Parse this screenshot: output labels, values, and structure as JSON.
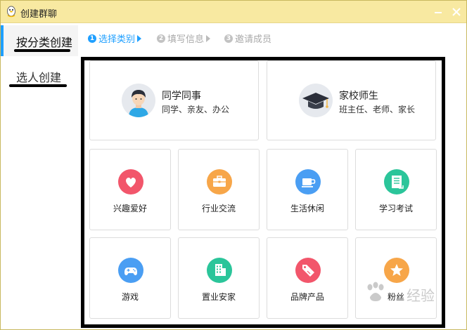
{
  "window": {
    "title": "创建群聊"
  },
  "sidebar": {
    "items": [
      {
        "label": "按分类创建",
        "active": true
      },
      {
        "label": "选人创建",
        "active": false
      }
    ]
  },
  "steps": [
    {
      "num": "1",
      "label": "选择类别",
      "active": true
    },
    {
      "num": "2",
      "label": "填写信息",
      "active": false
    },
    {
      "num": "3",
      "label": "邀请成员",
      "active": false
    }
  ],
  "big_cards": [
    {
      "title": "同学同事",
      "subtitle": "同学、亲友、办公",
      "icon": "student-avatar-icon"
    },
    {
      "title": "家校师生",
      "subtitle": "班主任、老师、家长",
      "icon": "graduation-cap-icon"
    }
  ],
  "categories": [
    {
      "label": "兴趣爱好",
      "icon": "heart-icon",
      "color": "#f2566b"
    },
    {
      "label": "行业交流",
      "icon": "briefcase-icon",
      "color": "#f7a649"
    },
    {
      "label": "生活休闲",
      "icon": "coffee-cup-icon",
      "color": "#4a9ef3"
    },
    {
      "label": "学习考试",
      "icon": "document-icon",
      "color": "#2bc59a"
    },
    {
      "label": "游戏",
      "icon": "gamepad-icon",
      "color": "#4a9ef3"
    },
    {
      "label": "置业安家",
      "icon": "building-icon",
      "color": "#2bc59a"
    },
    {
      "label": "品牌产品",
      "icon": "tag-icon",
      "color": "#f2566b"
    },
    {
      "label": "粉丝",
      "icon": "star-icon",
      "color": "#f7a649"
    }
  ],
  "watermark": {
    "text": "经验"
  }
}
